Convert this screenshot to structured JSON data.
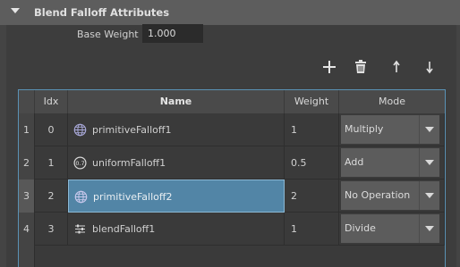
{
  "section": {
    "title": "Blend Falloff Attributes"
  },
  "base_weight": {
    "label": "Base Weight",
    "value": "1.000"
  },
  "toolbar": {
    "add_icon": "plus-icon",
    "delete_icon": "trash-icon",
    "up_icon": "arrow-up-icon",
    "down_icon": "arrow-down-icon"
  },
  "table": {
    "columns": [
      "Idx",
      "Name",
      "Weight",
      "Mode"
    ],
    "rows": [
      {
        "num": "1",
        "idx": "0",
        "name": "primitiveFalloff1",
        "weight": "1",
        "mode": "Multiply",
        "icon": "globe-icon"
      },
      {
        "num": "2",
        "idx": "1",
        "name": "uniformFalloff1",
        "weight": "0.5",
        "mode": "Add",
        "icon": "uniform-value-icon",
        "icon_text": "0.7"
      },
      {
        "num": "3",
        "idx": "2",
        "name": "primitiveFalloff2",
        "weight": "2",
        "mode": "No Operation",
        "icon": "globe-icon"
      },
      {
        "num": "4",
        "idx": "3",
        "name": "blendFalloff1",
        "weight": "1",
        "mode": "Divide",
        "icon": "sliders-icon"
      }
    ]
  },
  "colors": {
    "accent": "#5285a6",
    "selection_border": "#8bb8d4",
    "table_border": "#5a92b5"
  }
}
